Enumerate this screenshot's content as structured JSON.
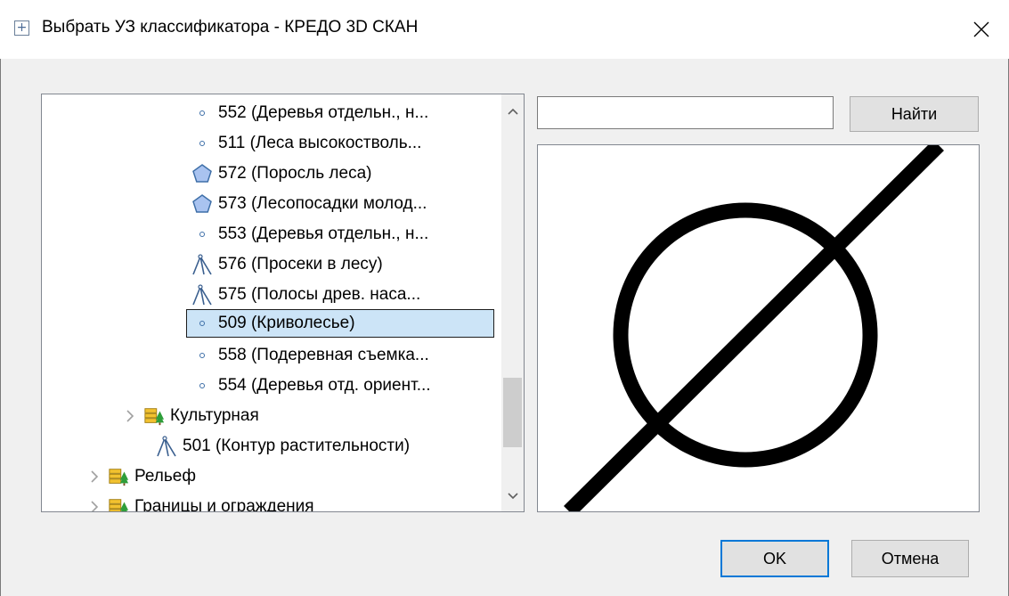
{
  "window": {
    "title": "Выбрать УЗ классификатора - КРЕДО 3D СКАН",
    "app_icon_glyph": "+",
    "close_icon": "close-icon"
  },
  "tree": {
    "items": [
      {
        "label": "552 (Деревья отдельн., н...",
        "icon": "point-icon"
      },
      {
        "label": "511 (Леса высокостволь...",
        "icon": "point-icon"
      },
      {
        "label": "572 (Поросль леса)",
        "icon": "polygon-icon"
      },
      {
        "label": "573 (Лесопосадки молод...",
        "icon": "polygon-icon"
      },
      {
        "label": "553 (Деревья отдельн., н...",
        "icon": "point-icon"
      },
      {
        "label": "576 (Просеки в лесу)",
        "icon": "polyline-icon"
      },
      {
        "label": "575 (Полосы древ. наса...",
        "icon": "polyline-icon"
      },
      {
        "label": "509 (Криволесье)",
        "icon": "point-icon",
        "selected": true
      },
      {
        "label": "558 (Подеревная съемка...",
        "icon": "point-icon"
      },
      {
        "label": "554 (Деревья отд. ориент...",
        "icon": "point-icon"
      },
      {
        "label": "Культурная",
        "icon": "layer-group-icon",
        "expandable": true
      },
      {
        "label": "501 (Контур растительности)",
        "icon": "polyline-icon"
      },
      {
        "label": "Рельеф",
        "icon": "layer-group-icon",
        "expandable": true
      },
      {
        "label": "Границы и ограждения",
        "icon": "layer-group-icon",
        "expandable": true
      }
    ]
  },
  "search": {
    "value": "",
    "placeholder": "",
    "find_label": "Найти"
  },
  "buttons": {
    "ok_label": "OK",
    "cancel_label": "Отмена"
  },
  "colors": {
    "accent": "#0078d7",
    "selection": "#cce4f7",
    "polygon_fill": "#a9c3f0"
  }
}
